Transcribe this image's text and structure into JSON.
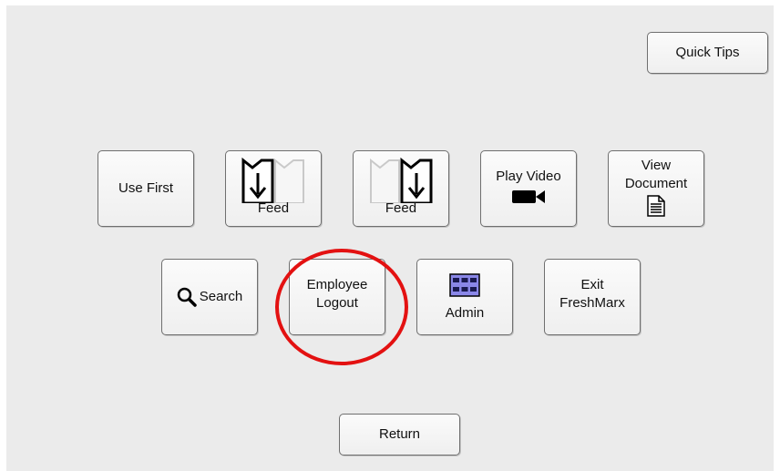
{
  "quick_tips": {
    "label": "Quick Tips"
  },
  "row1": {
    "use_first": {
      "label": "Use First"
    },
    "feed_left": {
      "label": "Feed",
      "icon": "feed-left-icon"
    },
    "feed_right": {
      "label": "Feed",
      "icon": "feed-right-icon"
    },
    "play_video": {
      "label": "Play Video",
      "icon": "video-camera-icon"
    },
    "view_document": {
      "label_line1": "View",
      "label_line2": "Document",
      "icon": "document-icon"
    }
  },
  "row2": {
    "search": {
      "label": "Search",
      "icon": "magnifier-icon"
    },
    "employee_logout": {
      "label_line1": "Employee",
      "label_line2": "Logout"
    },
    "admin": {
      "label": "Admin",
      "icon": "grid-panel-icon"
    },
    "exit": {
      "label_line1": "Exit",
      "label_line2": "FreshMarx"
    }
  },
  "return": {
    "label": "Return"
  },
  "colors": {
    "highlight": "#e31111",
    "admin_icon": "#8a87e8",
    "background": "#ebebeb"
  }
}
